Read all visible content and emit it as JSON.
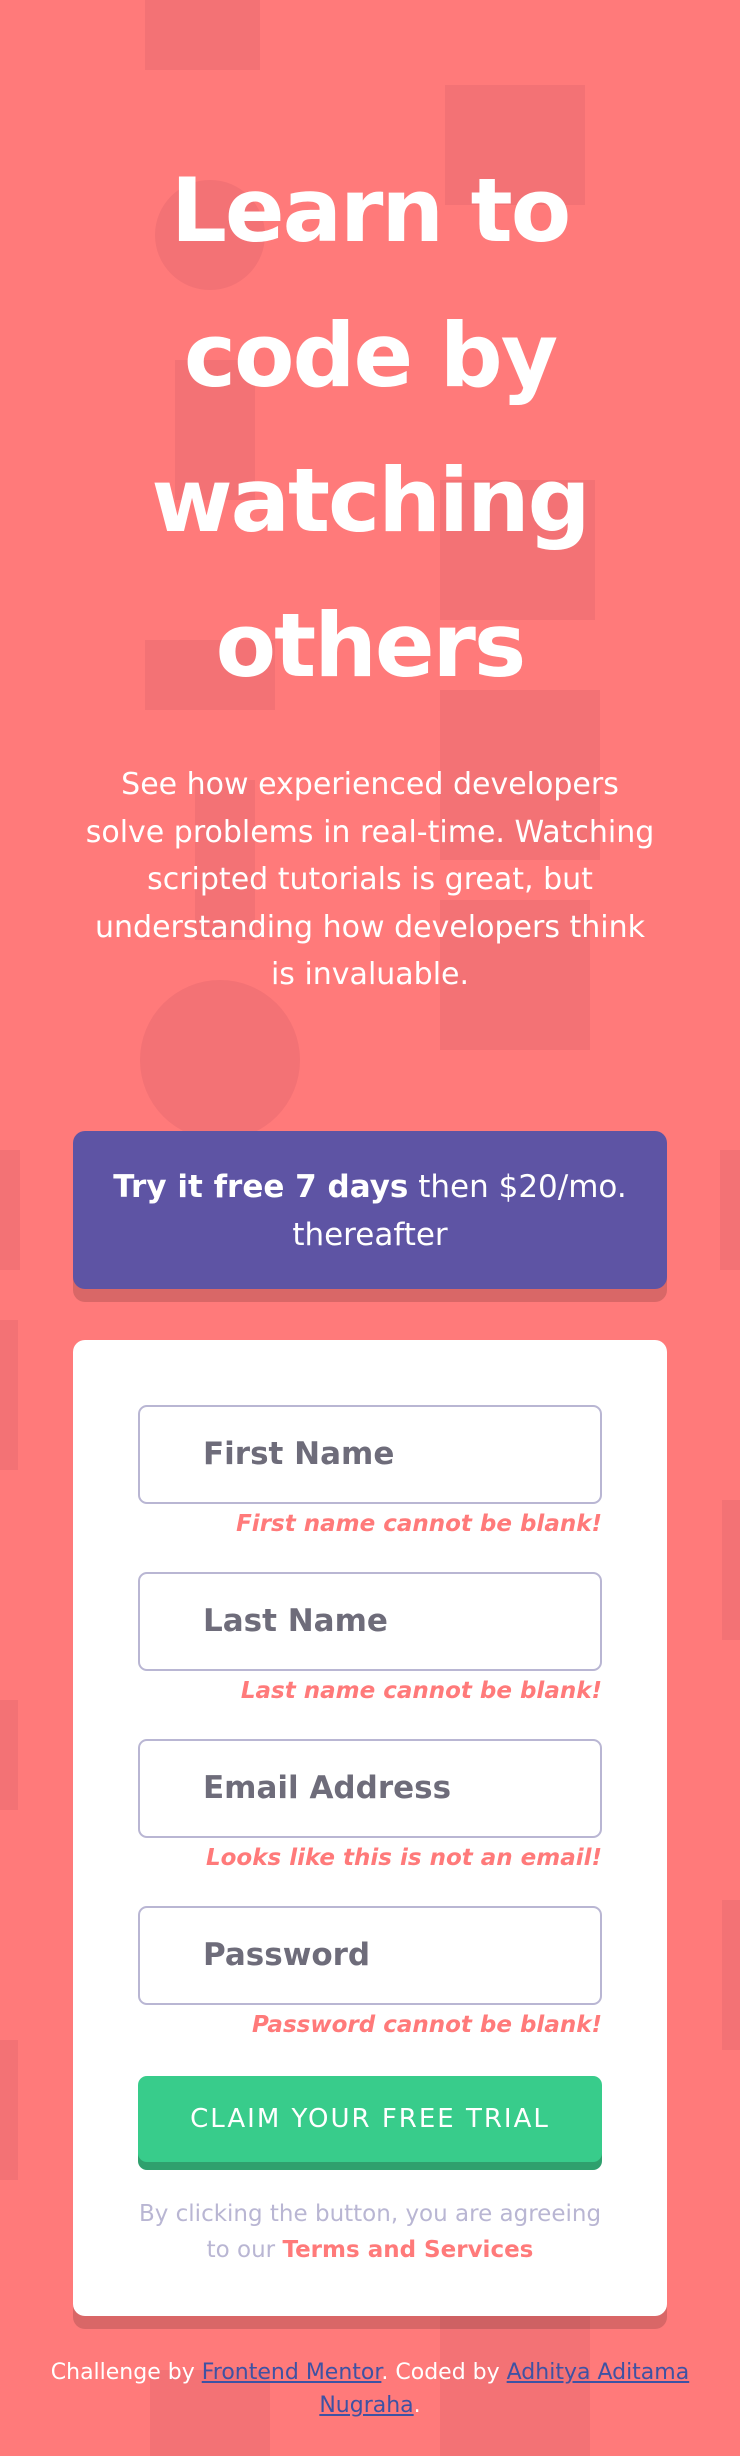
{
  "hero": {
    "headline": "Learn to code by watching others",
    "subtext": "See how experienced developers solve problems in real-time. Watching scripted tutorials is great, but understanding how developers think is invaluable."
  },
  "offer": {
    "bold": "Try it free 7 days",
    "rest": " then $20/mo. thereafter"
  },
  "form": {
    "fields": [
      {
        "placeholder": "First Name",
        "error": "First name cannot be blank!"
      },
      {
        "placeholder": "Last Name",
        "error": "Last name cannot be blank!"
      },
      {
        "placeholder": "Email Address",
        "error": "Looks like this is not an email!"
      },
      {
        "placeholder": "Password",
        "error": "Password cannot be blank!"
      }
    ],
    "submit_label": "CLAIM YOUR FREE TRIAL",
    "terms_prefix": "By clicking the button, you are agreeing to our ",
    "terms_link": "Terms and Services"
  },
  "footer": {
    "prefix": "Challenge by ",
    "mentor_link": "Frontend Mentor",
    "middle": ". Coded by ",
    "author_link": "Adhitya Aditama Nugraha",
    "suffix": "."
  },
  "colors": {
    "background": "#ff7a7a",
    "banner": "#5e54a4",
    "button": "#38cc8b",
    "error": "#ff7a7a",
    "link": "#3e52a3"
  }
}
